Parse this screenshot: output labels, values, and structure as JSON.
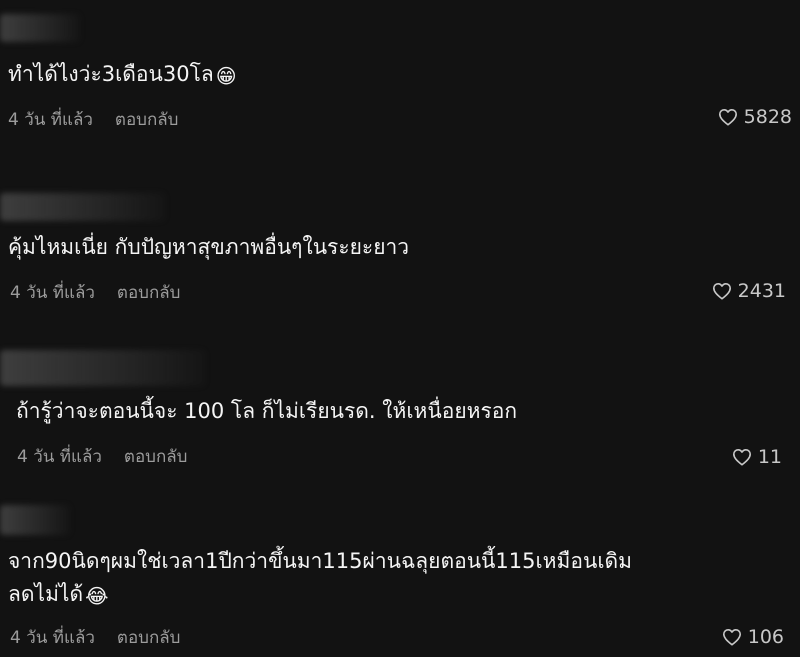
{
  "comments": [
    {
      "text": "ทำได้ไงว่ะ3เดือน30โล",
      "emoji": "😁",
      "time": "4 วัน ที่แล้ว",
      "reply_label": "ตอบกลับ",
      "likes": "5828"
    },
    {
      "text": "คุ้มไหมเนี่ย กับปัญหาสุขภาพอื่นๆในระยะยาว",
      "emoji": "",
      "time": "4 วัน ที่แล้ว",
      "reply_label": "ตอบกลับ",
      "likes": "2431"
    },
    {
      "text": "ถ้ารู้ว่าจะตอนนี้จะ 100 โล ก็ไม่เรียนรด. ให้เหนื่อยหรอก",
      "emoji": "",
      "time": "4 วัน ที่แล้ว",
      "reply_label": "ตอบกลับ",
      "likes": "11"
    },
    {
      "text_line1": "จาก90นิดๆผมใช่เวลา1ปีกว่าขึ้นมา115ผ่านฉลุยตอนนี้115เหมือนเดิม",
      "text_line2": "ลดไม่ได้",
      "emoji": "😂",
      "time": "4 วัน ที่แล้ว",
      "reply_label": "ตอบกลับ",
      "likes": "106"
    }
  ],
  "icons": {
    "like": "heart-icon"
  }
}
